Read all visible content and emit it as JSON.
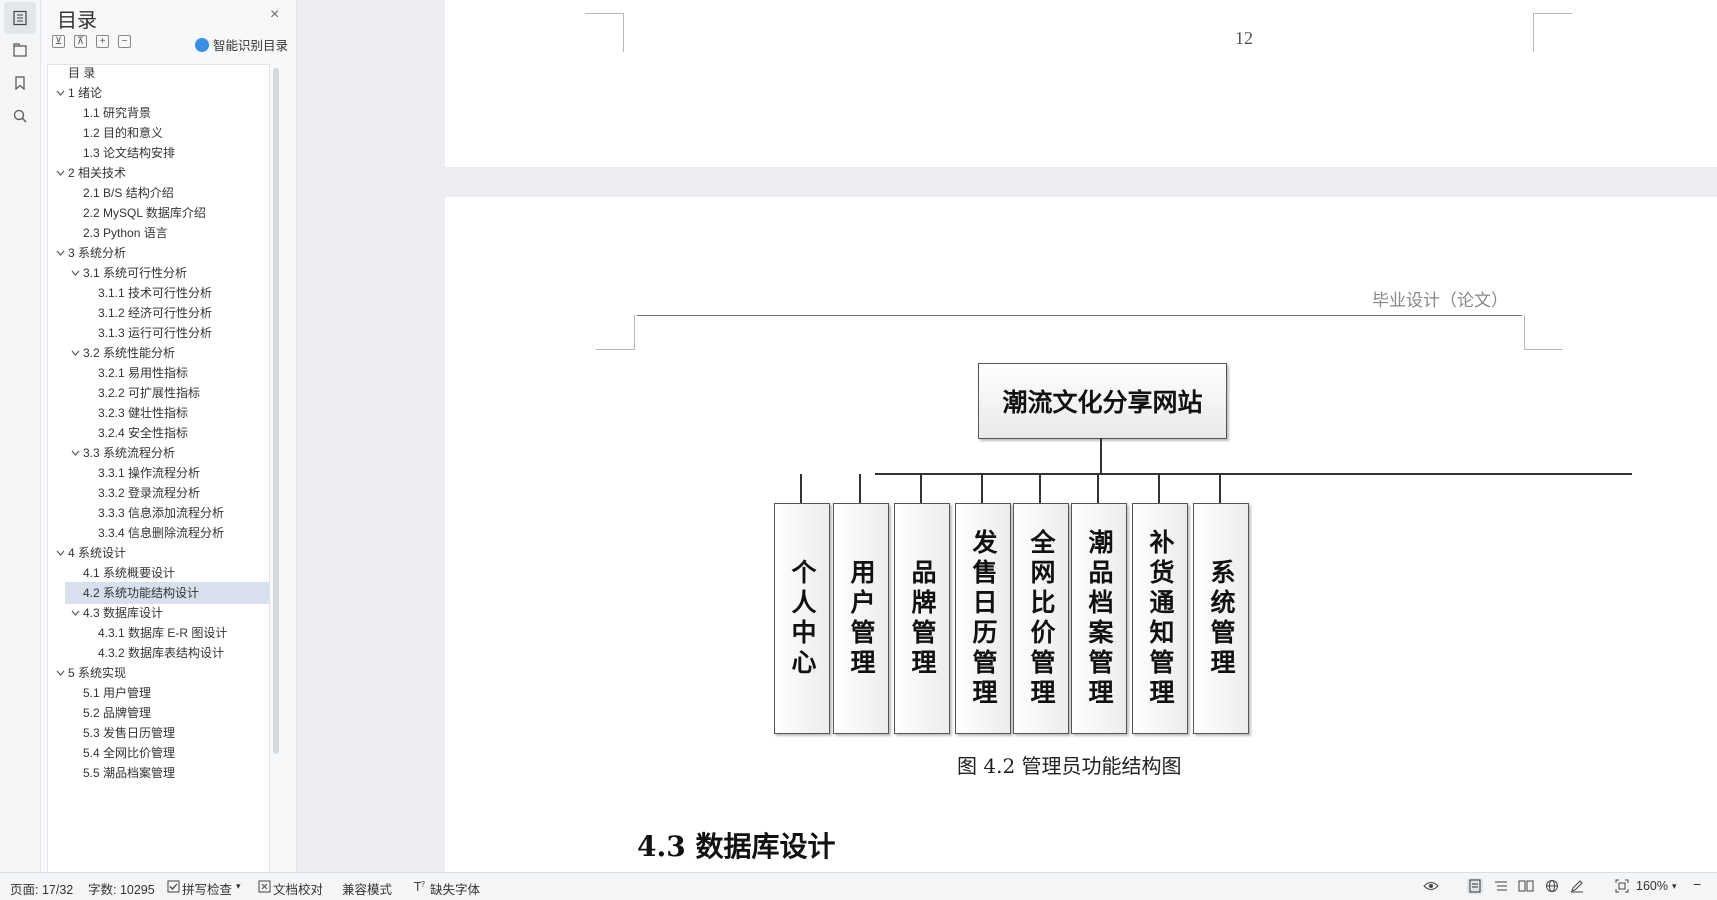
{
  "toc": {
    "title": "目录",
    "close": "×",
    "tools": [
      "⊻",
      "⊼",
      "+",
      "−"
    ],
    "smart_label": "智能识别目录",
    "items": [
      {
        "label": "目  录",
        "level": 1,
        "caret": ""
      },
      {
        "label": "1  绪论",
        "level": 1,
        "caret": "v"
      },
      {
        "label": "1.1  研究背景",
        "level": 2,
        "caret": ""
      },
      {
        "label": "1.2  目的和意义",
        "level": 2,
        "caret": ""
      },
      {
        "label": "1.3  论文结构安排",
        "level": 2,
        "caret": ""
      },
      {
        "label": "2  相关技术",
        "level": 1,
        "caret": "v"
      },
      {
        "label": "2.1 B/S 结构介绍",
        "level": 2,
        "caret": ""
      },
      {
        "label": "2.2 MySQL 数据库介绍",
        "level": 2,
        "caret": ""
      },
      {
        "label": "2.3 Python 语言",
        "level": 2,
        "caret": ""
      },
      {
        "label": "3  系统分析",
        "level": 1,
        "caret": "v"
      },
      {
        "label": "3.1  系统可行性分析",
        "level": 2,
        "caret": "v"
      },
      {
        "label": "3.1.1  技术可行性分析",
        "level": 3,
        "caret": ""
      },
      {
        "label": "3.1.2  经济可行性分析",
        "level": 3,
        "caret": ""
      },
      {
        "label": "3.1.3  运行可行性分析",
        "level": 3,
        "caret": ""
      },
      {
        "label": "3.2  系统性能分析",
        "level": 2,
        "caret": "v"
      },
      {
        "label": "3.2.1  易用性指标",
        "level": 3,
        "caret": ""
      },
      {
        "label": "3.2.2  可扩展性指标",
        "level": 3,
        "caret": ""
      },
      {
        "label": "3.2.3  健壮性指标",
        "level": 3,
        "caret": ""
      },
      {
        "label": "3.2.4  安全性指标",
        "level": 3,
        "caret": ""
      },
      {
        "label": "3.3  系统流程分析",
        "level": 2,
        "caret": "v"
      },
      {
        "label": "3.3.1  操作流程分析",
        "level": 3,
        "caret": ""
      },
      {
        "label": "3.3.2  登录流程分析",
        "level": 3,
        "caret": ""
      },
      {
        "label": "3.3.3  信息添加流程分析",
        "level": 3,
        "caret": ""
      },
      {
        "label": "3.3.4  信息删除流程分析",
        "level": 3,
        "caret": ""
      },
      {
        "label": "4  系统设计",
        "level": 1,
        "caret": "v"
      },
      {
        "label": "4.1  系统概要设计",
        "level": 2,
        "caret": ""
      },
      {
        "label": "4.2  系统功能结构设计",
        "level": 2,
        "caret": "",
        "selected": true
      },
      {
        "label": "4.3  数据库设计",
        "level": 2,
        "caret": "v"
      },
      {
        "label": "4.3.1  数据库 E-R 图设计",
        "level": 3,
        "caret": ""
      },
      {
        "label": "4.3.2  数据库表结构设计",
        "level": 3,
        "caret": ""
      },
      {
        "label": "5  系统实现",
        "level": 1,
        "caret": "v"
      },
      {
        "label": "5.1  用户管理",
        "level": 2,
        "caret": ""
      },
      {
        "label": "5.2  品牌管理",
        "level": 2,
        "caret": ""
      },
      {
        "label": "5.3  发售日历管理",
        "level": 2,
        "caret": ""
      },
      {
        "label": "5.4  全网比价管理",
        "level": 2,
        "caret": ""
      },
      {
        "label": "5.5  潮品档案管理",
        "level": 2,
        "caret": ""
      }
    ]
  },
  "document": {
    "page_number": "12",
    "header_text": "毕业设计（论文）",
    "diagram": {
      "root": "潮流文化分享网站",
      "children": [
        "个人中心",
        "用户管理",
        "品牌管理",
        "发售日历管理",
        "全网比价管理",
        "潮品档案管理",
        "补货通知管理",
        "系统管理"
      ]
    },
    "caption": "图 4.2  管理员功能结构图",
    "section_heading": "4.3  数据库设计"
  },
  "status": {
    "page": "页面: 17/32",
    "words": "字数: 10295",
    "spell": "拼写检查",
    "proof": "文档校对",
    "compat": "兼容模式",
    "missing_font": "缺失字体",
    "zoom": "160%",
    "zoom_minus": "−"
  }
}
